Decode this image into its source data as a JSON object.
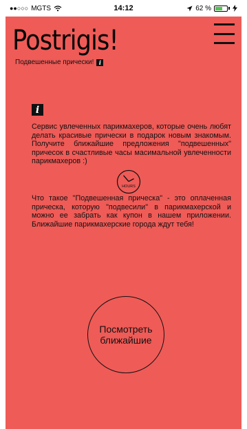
{
  "status_bar": {
    "signal": "●●○○○",
    "carrier": "MGTS",
    "wifi_icon": "wifi-icon",
    "time": "14:12",
    "location_icon": "location-arrow-icon",
    "battery_percent_text": "62 %",
    "battery_level": 0.62,
    "charging_icon": "charging-bolt-icon"
  },
  "header": {
    "title": "Postrigis!",
    "subtitle": "Подвешенные прически!",
    "info_icon": "i",
    "menu_icon": "hamburger-menu-icon"
  },
  "main": {
    "info_icon_text": "i",
    "description": "Сервис увлеченных парикмахеров, которые очень любят делать красивые прически в подарок новым знакомым. Получите ближайшие предложения \"подвешенных\" причесок в счастливые часы масимальной увлеченности парикмахеров :)",
    "hours_label": "HOURS",
    "definition": "Что такое \"Подвешенная прическа\" - это оплаченная прическа, которую \"подвесили\" в парикмахерской и можно ее забрать как купон в нашем приложении. Ближайшие парикмахерские города ждут тебя!",
    "button_label": "Посмотреть\nближайшие"
  },
  "colors": {
    "background": "#ef5b57",
    "text": "#111111",
    "battery": "#51c44f"
  }
}
